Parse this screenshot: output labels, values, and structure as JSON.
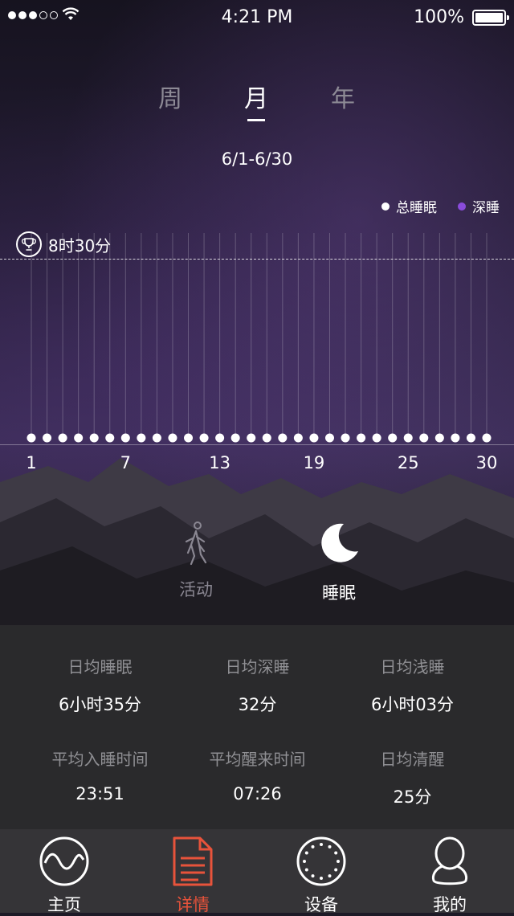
{
  "status_bar": {
    "time": "4:21 PM",
    "battery": "100%",
    "signal_bars_filled": 3,
    "signal_bars_total": 5
  },
  "period_tabs": [
    {
      "label": "周",
      "active": false
    },
    {
      "label": "月",
      "active": true
    },
    {
      "label": "年",
      "active": false
    }
  ],
  "date_range": "6/1-6/30",
  "legend": {
    "total_label": "总睡眠",
    "deep_label": "深睡",
    "total_color": "#ffffff",
    "deep_color": "#8a4bdc"
  },
  "goal": {
    "label": "8时30分",
    "icon": "trophy-icon"
  },
  "chart_data": {
    "type": "scatter",
    "x_ticks": [
      "1",
      "7",
      "13",
      "19",
      "25",
      "30"
    ],
    "days": [
      1,
      2,
      3,
      4,
      5,
      6,
      7,
      8,
      9,
      10,
      11,
      12,
      13,
      14,
      15,
      16,
      17,
      18,
      19,
      20,
      21,
      22,
      23,
      24,
      25,
      26,
      27,
      28,
      29,
      30
    ],
    "series": [
      {
        "name": "总睡眠",
        "values": [
          0,
          0,
          0,
          0,
          0,
          0,
          0,
          0,
          0,
          0,
          0,
          0,
          0,
          0,
          0,
          0,
          0,
          0,
          0,
          0,
          0,
          0,
          0,
          0,
          0,
          0,
          0,
          0,
          0,
          0
        ]
      }
    ],
    "goal_minutes": 510
  },
  "modes": [
    {
      "label": "活动",
      "icon": "walking-icon",
      "active": false
    },
    {
      "label": "睡眠",
      "icon": "moon-icon",
      "active": true
    }
  ],
  "stats": [
    {
      "title": "日均睡眠",
      "value": "6小时35分"
    },
    {
      "title": "日均深睡",
      "value": "32分"
    },
    {
      "title": "日均浅睡",
      "value": "6小时03分"
    },
    {
      "title": "平均入睡时间",
      "value": "23:51"
    },
    {
      "title": "平均醒来时间",
      "value": "07:26"
    },
    {
      "title": "日均清醒",
      "value": "25分"
    }
  ],
  "tabbar": [
    {
      "label": "主页",
      "icon": "wave-circle-icon",
      "active": false
    },
    {
      "label": "详情",
      "icon": "document-icon",
      "active": true
    },
    {
      "label": "设备",
      "icon": "watch-dial-icon",
      "active": false
    },
    {
      "label": "我的",
      "icon": "person-icon",
      "active": false
    }
  ],
  "colors": {
    "accent": "#e8533b",
    "panel": "#2a2a2c",
    "tabbar": "#353437"
  }
}
